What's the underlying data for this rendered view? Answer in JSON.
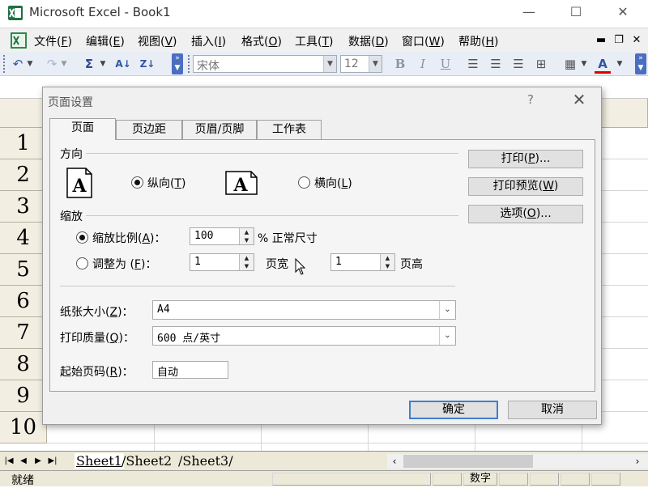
{
  "window": {
    "title": "Microsoft Excel - Book1"
  },
  "menu": {
    "items": [
      {
        "label": "文件",
        "key": "F"
      },
      {
        "label": "编辑",
        "key": "E"
      },
      {
        "label": "视图",
        "key": "V"
      },
      {
        "label": "插入",
        "key": "I"
      },
      {
        "label": "格式",
        "key": "O"
      },
      {
        "label": "工具",
        "key": "T"
      },
      {
        "label": "数据",
        "key": "D"
      },
      {
        "label": "窗口",
        "key": "W"
      },
      {
        "label": "帮助",
        "key": "H"
      }
    ]
  },
  "toolbar": {
    "font_name": "宋体",
    "font_size": "12",
    "bold": "B",
    "italic": "I",
    "underline": "U",
    "font_color_glyph": "A",
    "sum_glyph": "Σ"
  },
  "grid": {
    "rows": [
      "1",
      "2",
      "3",
      "4",
      "5",
      "6",
      "7",
      "8",
      "9",
      "10"
    ]
  },
  "sheets": {
    "tabs": [
      "Sheet1",
      "Sheet2",
      "Sheet3"
    ]
  },
  "status": {
    "ready": "就绪",
    "num": "数字"
  },
  "dialog": {
    "title": "页面设置",
    "help": "?",
    "tabs": [
      "页面",
      "页边距",
      "页眉/页脚",
      "工作表"
    ],
    "orientation": {
      "label": "方向",
      "portrait": {
        "label": "纵向",
        "key": "T"
      },
      "landscape": {
        "label": "横向",
        "key": "L"
      },
      "selected": "portrait"
    },
    "scaling": {
      "label": "缩放",
      "adjust": {
        "label": "缩放比例",
        "key": "A",
        "suffix": "：",
        "value": "100",
        "unit": "% 正常尺寸"
      },
      "fit": {
        "label": "调整为",
        "key": "F",
        "suffix": "：",
        "wide_value": "1",
        "wide_label": "页宽",
        "tall_value": "1",
        "tall_label": "页高"
      },
      "selected": "adjust"
    },
    "paper_size": {
      "label": "纸张大小",
      "key": "Z",
      "value": "A4"
    },
    "print_quality": {
      "label": "打印质量",
      "key": "Q",
      "value": "600 点/英寸"
    },
    "first_page": {
      "label": "起始页码",
      "key": "R",
      "value": "自动"
    },
    "buttons": {
      "print": {
        "label": "打印",
        "key": "P",
        "ellipsis": "..."
      },
      "preview": {
        "label": "打印预览",
        "key": "W"
      },
      "options": {
        "label": "选项",
        "key": "O",
        "ellipsis": "..."
      },
      "ok": "确定",
      "cancel": "取消"
    },
    "icon_letter": "A"
  }
}
